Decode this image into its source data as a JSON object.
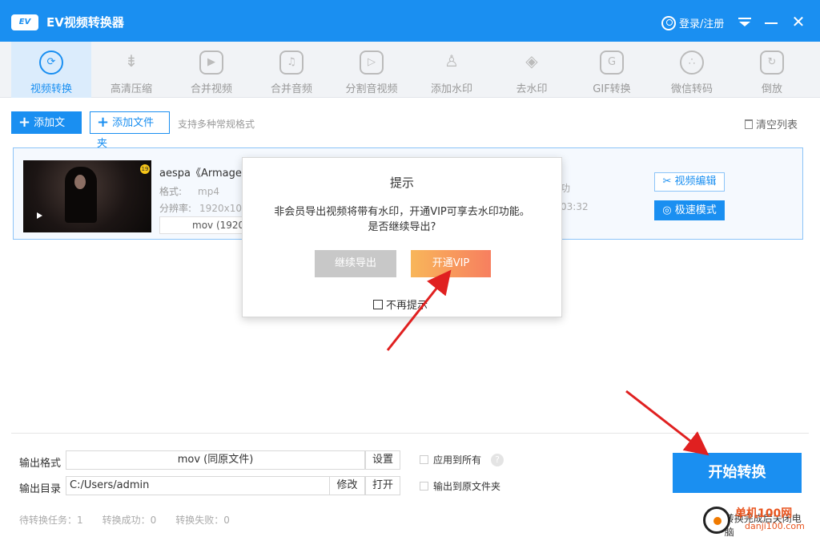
{
  "app": {
    "logo_text": "EV",
    "title": "EV视频转换器",
    "login_label": "登录/注册"
  },
  "toolbar": {
    "items": [
      {
        "label": "视频转换",
        "icon": "convert-icon"
      },
      {
        "label": "高清压缩",
        "icon": "compress-icon"
      },
      {
        "label": "合并视频",
        "icon": "merge-video-icon"
      },
      {
        "label": "合并音频",
        "icon": "merge-audio-icon"
      },
      {
        "label": "分割音视频",
        "icon": "split-icon"
      },
      {
        "label": "添加水印",
        "icon": "stamp-icon"
      },
      {
        "label": "去水印",
        "icon": "drop-icon"
      },
      {
        "label": "GIF转换",
        "icon": "gif-icon"
      },
      {
        "label": "微信转码",
        "icon": "wechat-icon"
      },
      {
        "label": "倒放",
        "icon": "reverse-icon"
      }
    ]
  },
  "actions": {
    "add_file": "添加文件",
    "add_folder": "添加文件夹",
    "hint": "支持多种常规格式",
    "clear": "清空列表"
  },
  "file": {
    "name": "aespa《Armaged",
    "format_label": "格式:",
    "format_value": "mp4",
    "resolution_label": "分辨率:",
    "resolution_value": "1920x10",
    "output_format": "mov (1920x",
    "hidden_right_1": "功",
    "hidden_right_2": "03:32",
    "edit_label": "视频编辑",
    "speed_label": "极速模式"
  },
  "dialog": {
    "title": "提示",
    "message_line1": "非会员导出视频将带有水印，开通VIP可享去水印功能。",
    "message_line2": "是否继续导出?",
    "continue_label": "继续导出",
    "vip_label": "开通VIP",
    "noask_label": "不再提示"
  },
  "bottom": {
    "output_format_label": "输出格式",
    "output_format_value": "mov (同原文件)",
    "settings_label": "设置",
    "output_dir_label": "输出目录",
    "output_dir_value": "C:/Users/admin",
    "modify_label": "修改",
    "open_label": "打开",
    "apply_all_label": "应用到所有",
    "output_to_source_label": "输出到原文件夹",
    "start_label": "开始转换",
    "pending_label": "待转换任务：1",
    "success_label": "转换成功：0",
    "failed_label": "转换失败：0",
    "shutdown_label": "转换完成后关闭电脑"
  },
  "watermark": {
    "line1": "单机100网",
    "line2": "danji100.com"
  },
  "colors": {
    "primary": "#1a8ff1",
    "vip_gradient_start": "#f8b65a",
    "vip_gradient_end": "#f77f5f",
    "annotation_arrow": "#e02020"
  }
}
